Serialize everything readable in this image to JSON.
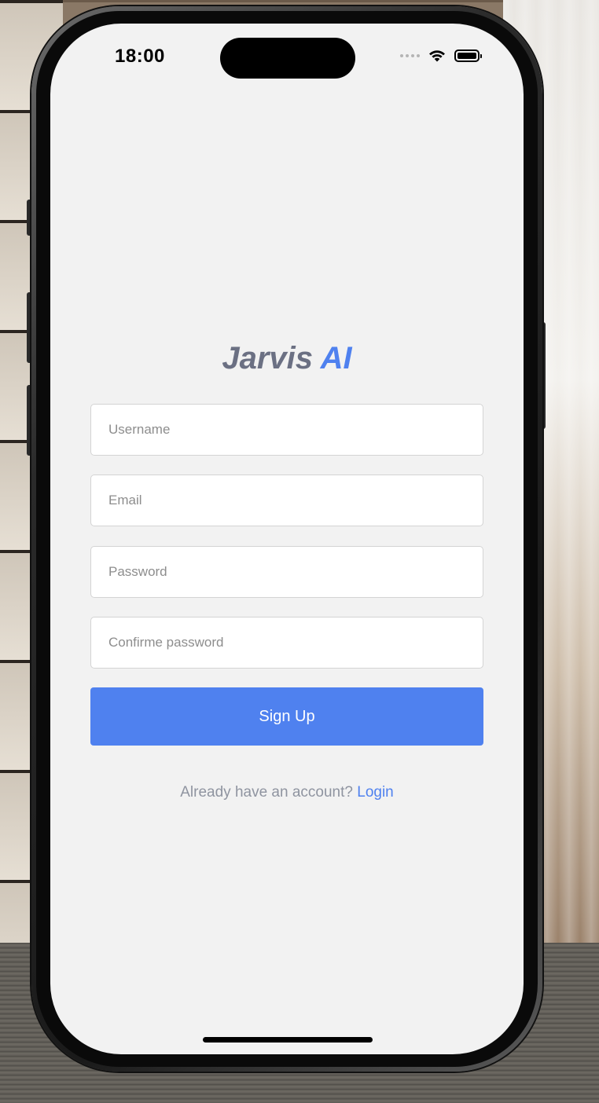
{
  "status_bar": {
    "time": "18:00",
    "signal_icon": "signal-dots-icon",
    "wifi_icon": "wifi-icon",
    "battery_icon": "battery-icon"
  },
  "brand": {
    "name_part1": "Jarvis",
    "name_part2": "AI",
    "color_primary": "#6b7083",
    "color_accent": "#4f81ef"
  },
  "form": {
    "username_placeholder": "Username",
    "email_placeholder": "Email",
    "password_placeholder": "Password",
    "confirm_password_placeholder": "Confirme password",
    "username_value": "",
    "email_value": "",
    "password_value": "",
    "confirm_password_value": "",
    "submit_label": "Sign Up"
  },
  "footer": {
    "prompt_text": "Already have an account?",
    "login_label": "Login"
  }
}
